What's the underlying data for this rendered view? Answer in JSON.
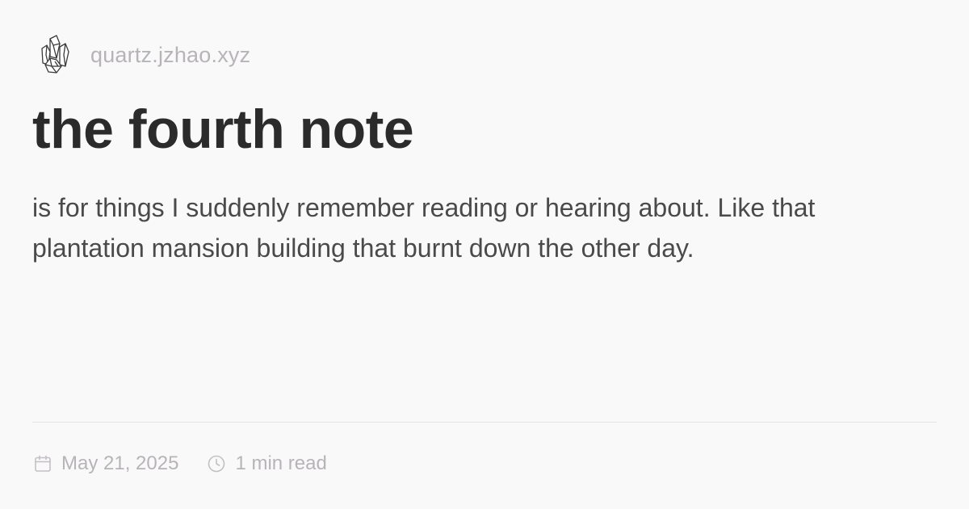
{
  "site": {
    "name": "quartz.jzhao.xyz",
    "logo_icon": "crystal-icon"
  },
  "note": {
    "title": "the fourth note",
    "description": "is for things I suddenly remember reading or hearing about. Like that plantation mansion building that burnt down the other day."
  },
  "meta": {
    "date": "May 21, 2025",
    "date_icon": "calendar-icon",
    "reading_time": "1 min read",
    "reading_time_icon": "clock-icon"
  },
  "colors": {
    "background": "#faf9fa",
    "title": "#2b2b2b",
    "body_text": "#4a4a4a",
    "muted": "#b7b4b8",
    "divider": "#e6e3e6"
  }
}
